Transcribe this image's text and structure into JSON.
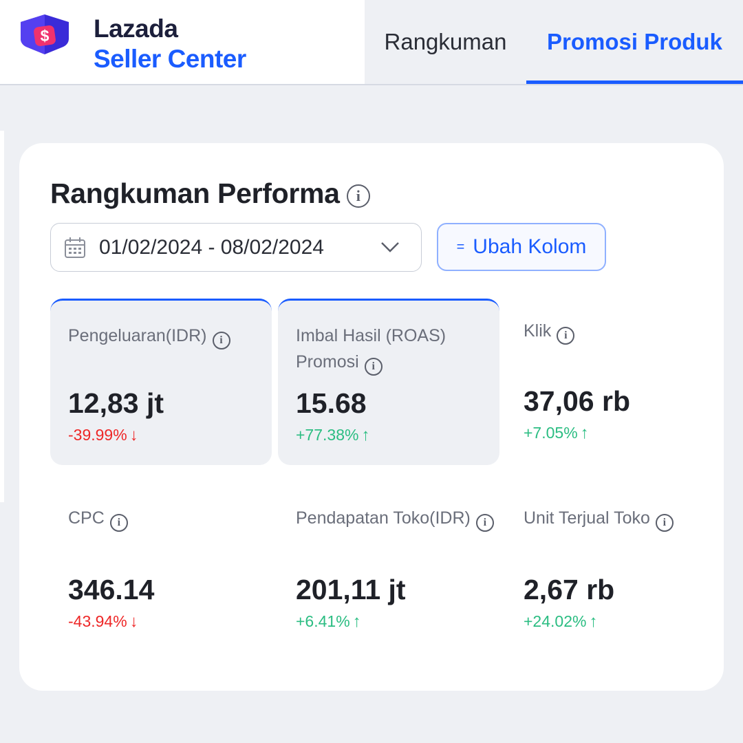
{
  "brand": {
    "name": "Lazada",
    "sub": "Seller Center"
  },
  "tabs": [
    {
      "label": "Rangkuman",
      "active": false
    },
    {
      "label": "Promosi Produk",
      "active": true
    }
  ],
  "summary": {
    "title": "Rangkuman Performa",
    "date_range": "01/02/2024 - 08/02/2024",
    "columns_button": "Ubah Kolom"
  },
  "metrics": [
    {
      "label": "Pengeluaran(IDR)",
      "value": "12,83 jt",
      "change": "-39.99%",
      "trend": "down",
      "arrow": "↓",
      "active": true
    },
    {
      "label": "Imbal Hasil (ROAS) Promosi",
      "value": "15.68",
      "change": "+77.38%",
      "trend": "up",
      "arrow": "↑",
      "active": true
    },
    {
      "label": "Klik",
      "value": "37,06 rb",
      "change": "+7.05%",
      "trend": "up",
      "arrow": "↑",
      "active": false
    },
    {
      "label": "CPC",
      "value": "346.14",
      "change": "-43.94%",
      "trend": "down",
      "arrow": "↓",
      "active": false
    },
    {
      "label": "Pendapatan Toko(IDR)",
      "value": "201,11 jt",
      "change": "+6.41%",
      "trend": "up",
      "arrow": "↑",
      "active": false
    },
    {
      "label": "Unit Terjual Toko",
      "value": "2,67 rb",
      "change": "+24.02%",
      "trend": "up",
      "arrow": "↑",
      "active": false
    }
  ],
  "colors": {
    "accent": "#1a5cff",
    "up": "#2bbd82",
    "down": "#ee2727",
    "logo": "#4b35e6"
  }
}
